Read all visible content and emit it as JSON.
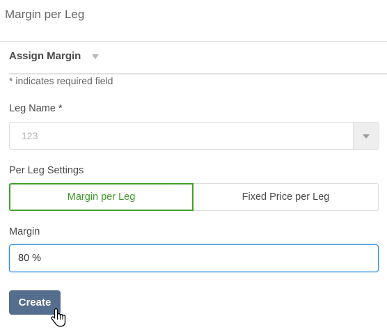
{
  "page": {
    "title": "Margin per Leg"
  },
  "section": {
    "title": "Assign Margin",
    "required_note": "* indicates required field"
  },
  "leg_name": {
    "label": "Leg Name *",
    "value": "123"
  },
  "per_leg_settings": {
    "label": "Per Leg Settings",
    "options": [
      {
        "label": "Margin per Leg",
        "selected": true
      },
      {
        "label": "Fixed Price per Leg",
        "selected": false
      }
    ]
  },
  "margin": {
    "label": "Margin",
    "value": "80 %"
  },
  "actions": {
    "create_label": "Create"
  },
  "colors": {
    "accent_green": "#43a029",
    "focus_blue": "#2d8ae0",
    "button_bg": "#566e8d"
  }
}
